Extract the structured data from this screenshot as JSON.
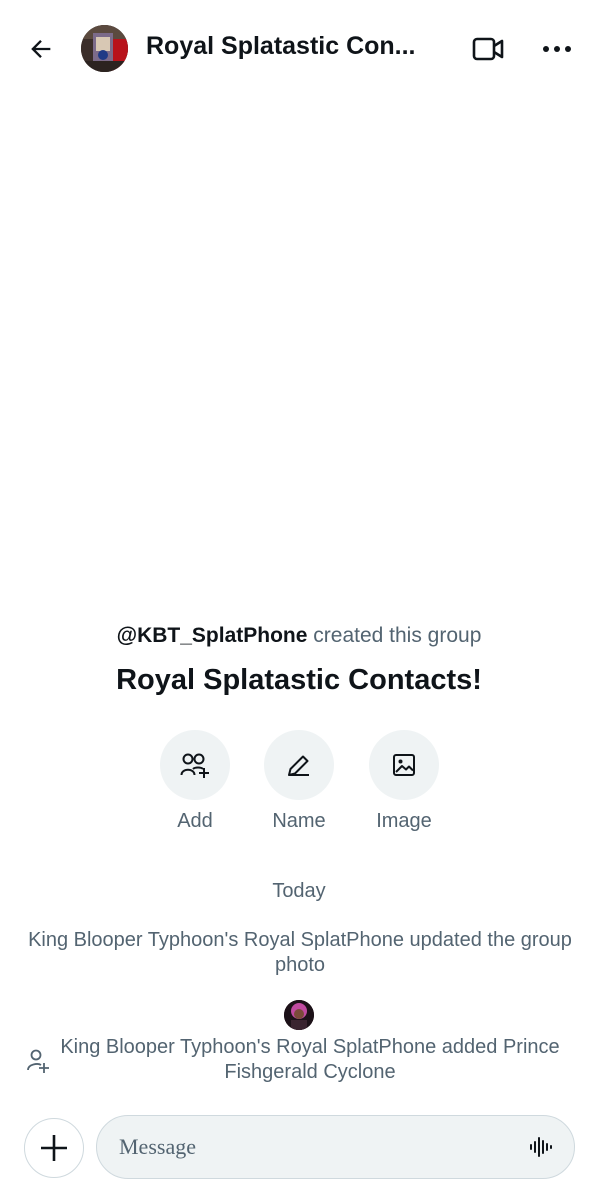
{
  "header": {
    "title": "Royal Splatastic Con...",
    "back_icon": "arrow-left-icon",
    "video_icon": "video-call-icon",
    "more_icon": "more-horizontal-icon"
  },
  "group": {
    "creator_handle": "@KBT_SplatPhone",
    "created_text": " created this group",
    "name": "Royal Splatastic Contacts!"
  },
  "actions": [
    {
      "label": "Add",
      "icon": "add-people-icon"
    },
    {
      "label": "Name",
      "icon": "pencil-icon"
    },
    {
      "label": "Image",
      "icon": "image-icon"
    }
  ],
  "timeline": {
    "day_label": "Today",
    "events": [
      {
        "text": "King Blooper Typhoon's Royal SplatPhone updated the group photo"
      },
      {
        "text": "King Blooper Typhoon's Royal SplatPhone added Prince Fishgerald Cyclone",
        "icon": "add-person-icon"
      }
    ]
  },
  "composer": {
    "placeholder": "Message",
    "plus_icon": "plus-icon",
    "voice_icon": "voice-waveform-icon"
  },
  "colors": {
    "text_primary": "#0f1419",
    "text_secondary": "#536471",
    "surface": "#eff3f4",
    "border": "#cfd9de"
  }
}
